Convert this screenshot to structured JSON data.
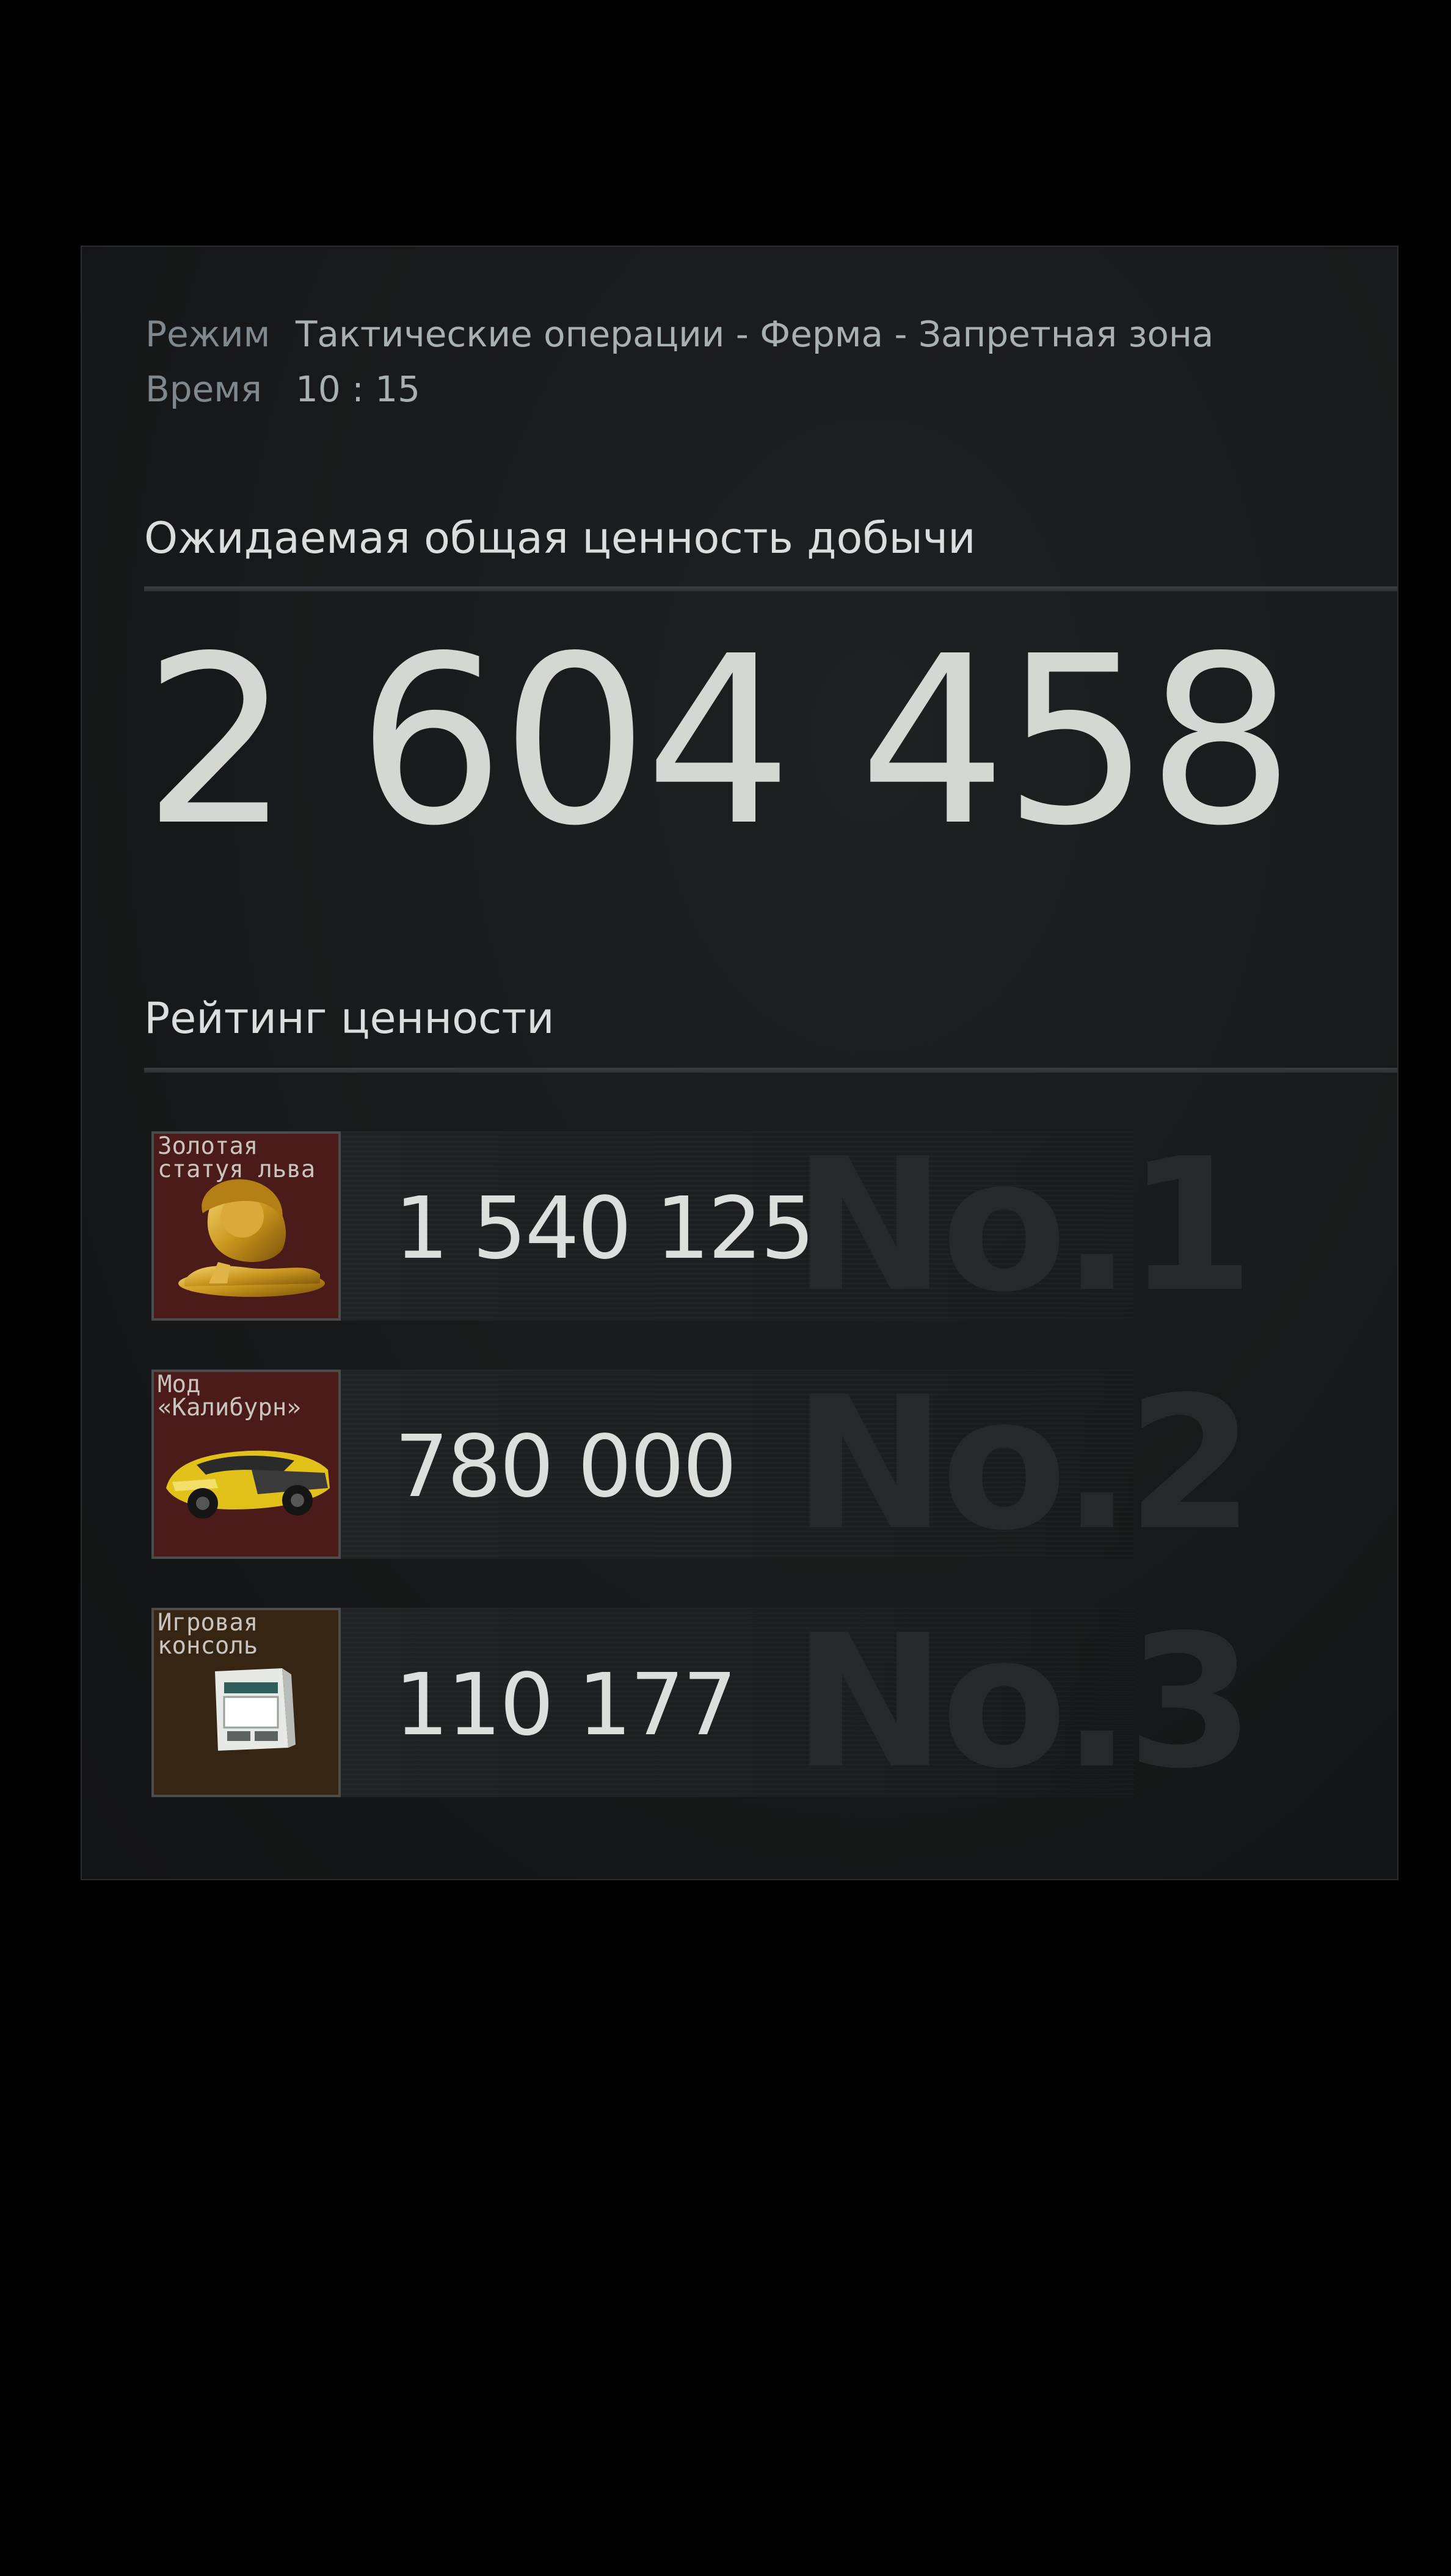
{
  "meta": {
    "mode_label": "Режим",
    "mode_value": "Тактические операции - Ферма - Запретная зона",
    "time_label": "Время",
    "time_value": "10 : 15"
  },
  "total": {
    "title": "Ожидаемая общая ценность добычи",
    "value": "2 604 458"
  },
  "ranking": {
    "title": "Рейтинг ценности",
    "items": [
      {
        "name": "Золотая статуя льва",
        "value": "1 540 125",
        "rank": "No.1",
        "icon": "gold-lion-statue-icon",
        "card_color": "#4a1b19"
      },
      {
        "name": "Мод «Калибурн»",
        "value": "780 000",
        "rank": "No.2",
        "icon": "yellow-sports-car-icon",
        "card_color": "#4a1b19"
      },
      {
        "name": "Игровая консоль",
        "value": "110 177",
        "rank": "No.3",
        "icon": "game-console-icon",
        "card_color": "#372514"
      }
    ]
  },
  "colors": {
    "background": "#000000",
    "panel": "#17191a",
    "text_primary": "#dadfdd",
    "text_label": "#7f898d"
  }
}
